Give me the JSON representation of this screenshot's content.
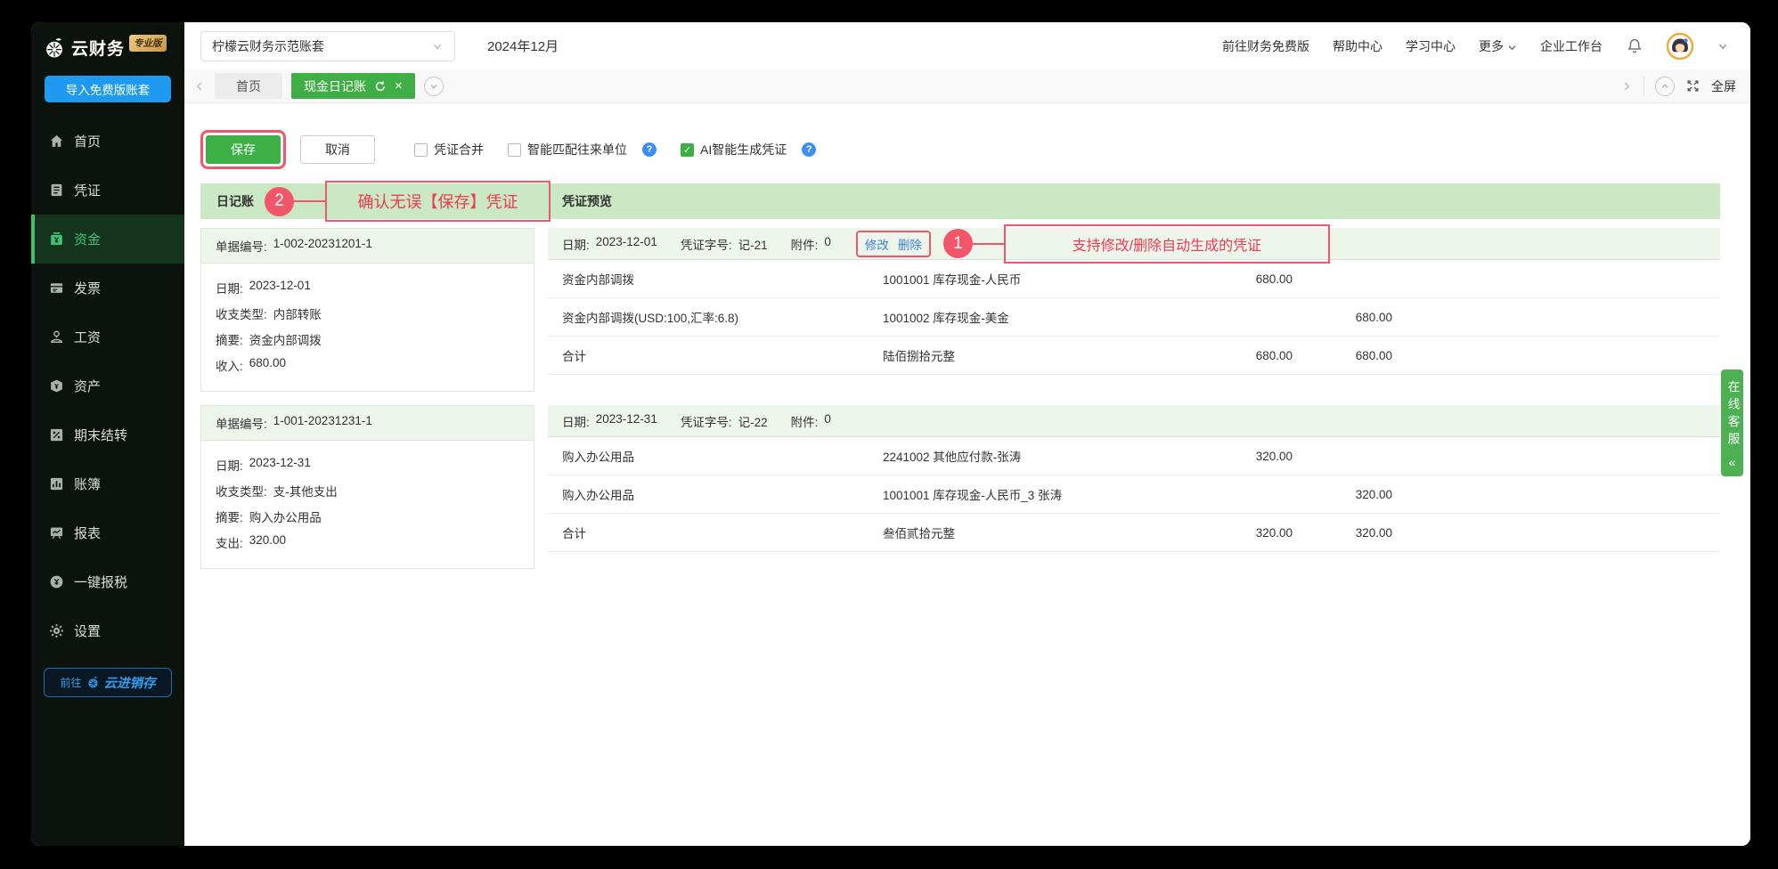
{
  "brand": {
    "name": "云财务",
    "badge": "专业版",
    "import_button": "导入免费版账套",
    "goto_prefix": "前往",
    "goto_brand": "云进销存"
  },
  "sidebar": {
    "items": [
      {
        "label": "首页",
        "active": false
      },
      {
        "label": "凭证",
        "active": false
      },
      {
        "label": "资金",
        "active": true
      },
      {
        "label": "发票",
        "active": false
      },
      {
        "label": "工资",
        "active": false
      },
      {
        "label": "资产",
        "active": false
      },
      {
        "label": "期末结转",
        "active": false
      },
      {
        "label": "账簿",
        "active": false
      },
      {
        "label": "报表",
        "active": false
      },
      {
        "label": "一键报税",
        "active": false
      },
      {
        "label": "设置",
        "active": false
      }
    ]
  },
  "topbar": {
    "account_set": "柠檬云财务示范账套",
    "period": "2024年12月",
    "links": [
      {
        "label": "前往财务免费版"
      },
      {
        "label": "帮助中心"
      },
      {
        "label": "学习中心"
      },
      {
        "label": "更多",
        "dropdown": true
      },
      {
        "label": "企业工作台"
      }
    ]
  },
  "tabbar": {
    "tabs": [
      {
        "label": "首页",
        "active": false
      },
      {
        "label": "现金日记账",
        "active": true
      }
    ],
    "fullscreen_label": "全屏"
  },
  "toolbar": {
    "save_label": "保存",
    "cancel_label": "取消",
    "checkboxes": [
      {
        "label": "凭证合并",
        "checked": false,
        "help": false
      },
      {
        "label": "智能匹配往来单位",
        "checked": false,
        "help": true
      },
      {
        "label": "AI智能生成凭证",
        "checked": true,
        "help": true
      }
    ]
  },
  "band": {
    "journal_label": "日记账",
    "preview_label": "凭证预览"
  },
  "annotations": {
    "step2": {
      "num": "2",
      "text": "确认无误【保存】凭证"
    },
    "step1": {
      "num": "1",
      "text": "支持修改/删除自动生成的凭证"
    }
  },
  "entries": [
    {
      "doc": {
        "label": "单据编号:",
        "value": "1-002-20231201-1"
      },
      "fields": [
        {
          "label": "日期:",
          "value": "2023-12-01"
        },
        {
          "label": "收支类型:",
          "value": "内部转账"
        },
        {
          "label": "摘要:",
          "value": "资金内部调拨"
        },
        {
          "label": "收入:",
          "value": "680.00"
        }
      ],
      "voucher": {
        "pairs": [
          {
            "label": "日期:",
            "value": "2023-12-01"
          },
          {
            "label": "凭证字号:",
            "value": "记-21"
          },
          {
            "label": "附件:",
            "value": "0"
          }
        ],
        "edit_label": "修改",
        "delete_label": "删除",
        "rows": [
          {
            "summary": "资金内部调拨",
            "account": "1001001 库存现金-人民币",
            "debit": "680.00",
            "credit": ""
          },
          {
            "summary": "资金内部调拨(USD:100,汇率:6.8)",
            "account": "1001002 库存现金-美金",
            "debit": "",
            "credit": "680.00"
          },
          {
            "summary": "合计",
            "account": "陆佰捌拾元整",
            "debit": "680.00",
            "credit": "680.00"
          }
        ]
      }
    },
    {
      "doc": {
        "label": "单据编号:",
        "value": "1-001-20231231-1"
      },
      "fields": [
        {
          "label": "日期:",
          "value": "2023-12-31"
        },
        {
          "label": "收支类型:",
          "value": "支-其他支出"
        },
        {
          "label": "摘要:",
          "value": "购入办公用品"
        },
        {
          "label": "支出:",
          "value": "320.00"
        }
      ],
      "voucher": {
        "pairs": [
          {
            "label": "日期:",
            "value": "2023-12-31"
          },
          {
            "label": "凭证字号:",
            "value": "记-22"
          },
          {
            "label": "附件:",
            "value": "0"
          }
        ],
        "rows": [
          {
            "summary": "购入办公用品",
            "account": "2241002 其他应付款-张涛",
            "debit": "320.00",
            "credit": ""
          },
          {
            "summary": "购入办公用品",
            "account": "1001001 库存现金-人民币_3 张涛",
            "debit": "",
            "credit": "320.00"
          },
          {
            "summary": "合计",
            "account": "叁佰贰拾元整",
            "debit": "320.00",
            "credit": "320.00"
          }
        ]
      }
    }
  ],
  "support": {
    "label": "在线客服",
    "collapse_icon": "«"
  },
  "icons": {
    "help": "?",
    "close": "×",
    "check": "✓"
  },
  "colors": {
    "primary_green": "#3cb047",
    "band_green": "#c9e8c3",
    "annotation_red": "#f2566b",
    "link_blue": "#3e7fd8",
    "brand_blue": "#1e9bf0",
    "sidebar_bg": "#0c120c"
  }
}
